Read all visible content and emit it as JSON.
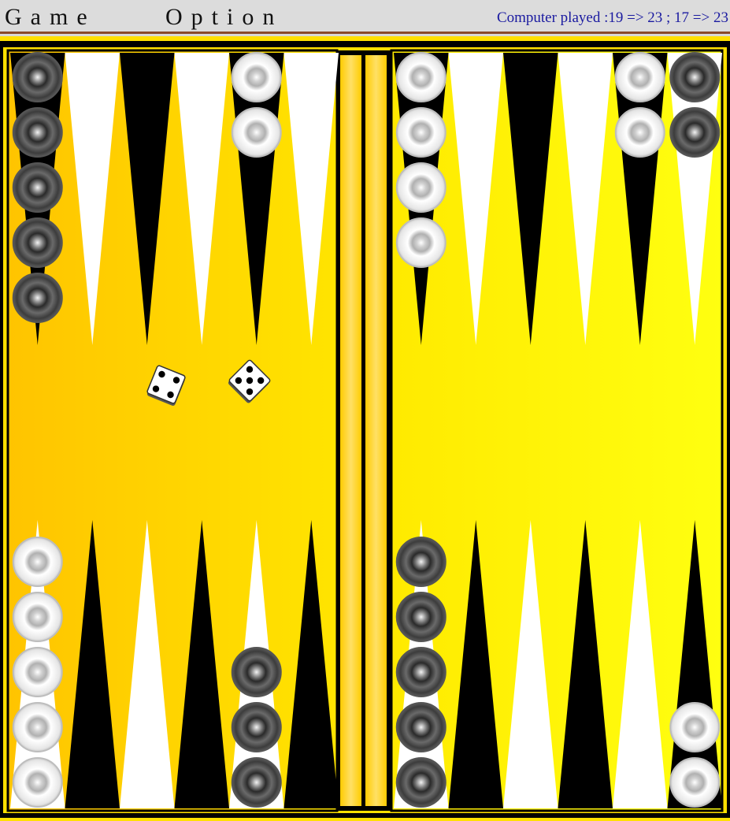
{
  "menu": {
    "game_label": "Game",
    "option_label": "Option"
  },
  "status": {
    "last_move_text": "Computer played :19 => 23 ; 17 => 23"
  },
  "colors": {
    "board_left": "#ffcc00",
    "board_right": "#ffff00",
    "frame": "#000000",
    "point_dark": "#000000",
    "point_light": "#ffffff",
    "menu_border": "#8a4a2a",
    "status_text": "#1a1aa0"
  },
  "board": {
    "top_points": [
      {
        "color": "dark",
        "checkers": {
          "color": "black",
          "count": 5
        }
      },
      {
        "color": "light",
        "checkers": null
      },
      {
        "color": "dark",
        "checkers": null
      },
      {
        "color": "light",
        "checkers": null
      },
      {
        "color": "dark",
        "checkers": {
          "color": "white",
          "count": 2
        }
      },
      {
        "color": "light",
        "checkers": null
      },
      {
        "color": "dark",
        "checkers": {
          "color": "white",
          "count": 4
        }
      },
      {
        "color": "light",
        "checkers": null
      },
      {
        "color": "dark",
        "checkers": null
      },
      {
        "color": "light",
        "checkers": null
      },
      {
        "color": "dark",
        "checkers": {
          "color": "white",
          "count": 2
        }
      },
      {
        "color": "light",
        "checkers": {
          "color": "black",
          "count": 2
        }
      }
    ],
    "bottom_points": [
      {
        "color": "light",
        "checkers": {
          "color": "white",
          "count": 5
        }
      },
      {
        "color": "dark",
        "checkers": null
      },
      {
        "color": "light",
        "checkers": null
      },
      {
        "color": "dark",
        "checkers": null
      },
      {
        "color": "light",
        "checkers": {
          "color": "black",
          "count": 3
        }
      },
      {
        "color": "dark",
        "checkers": null
      },
      {
        "color": "light",
        "checkers": {
          "color": "black",
          "count": 5
        }
      },
      {
        "color": "dark",
        "checkers": null
      },
      {
        "color": "light",
        "checkers": null
      },
      {
        "color": "dark",
        "checkers": null
      },
      {
        "color": "light",
        "checkers": null
      },
      {
        "color": "dark",
        "checkers": {
          "color": "white",
          "count": 2
        }
      }
    ],
    "dice": [
      4,
      5
    ]
  }
}
